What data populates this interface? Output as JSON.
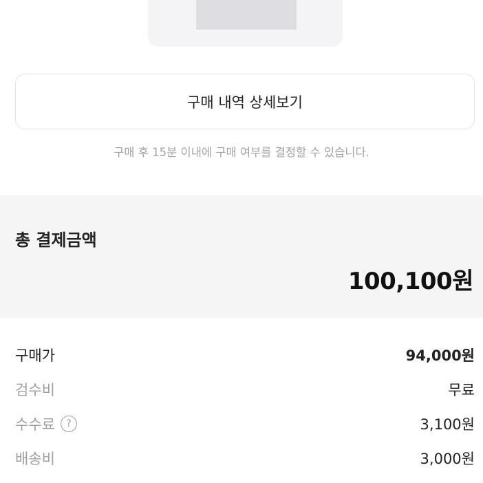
{
  "purchase_detail": {
    "button_label": "구매 내역 상세보기",
    "notice": "구매 후 15분 이내에 구매 여부를 결정할 수 있습니다."
  },
  "total": {
    "label": "총 결제금액",
    "amount": "100,100원"
  },
  "breakdown": [
    {
      "label": "구매가",
      "value": "94,000원"
    },
    {
      "label": "검수비",
      "value": "무료"
    },
    {
      "label": "수수료",
      "value": "3,100원",
      "help_icon": "?"
    },
    {
      "label": "배송비",
      "value": "3,000원"
    }
  ]
}
